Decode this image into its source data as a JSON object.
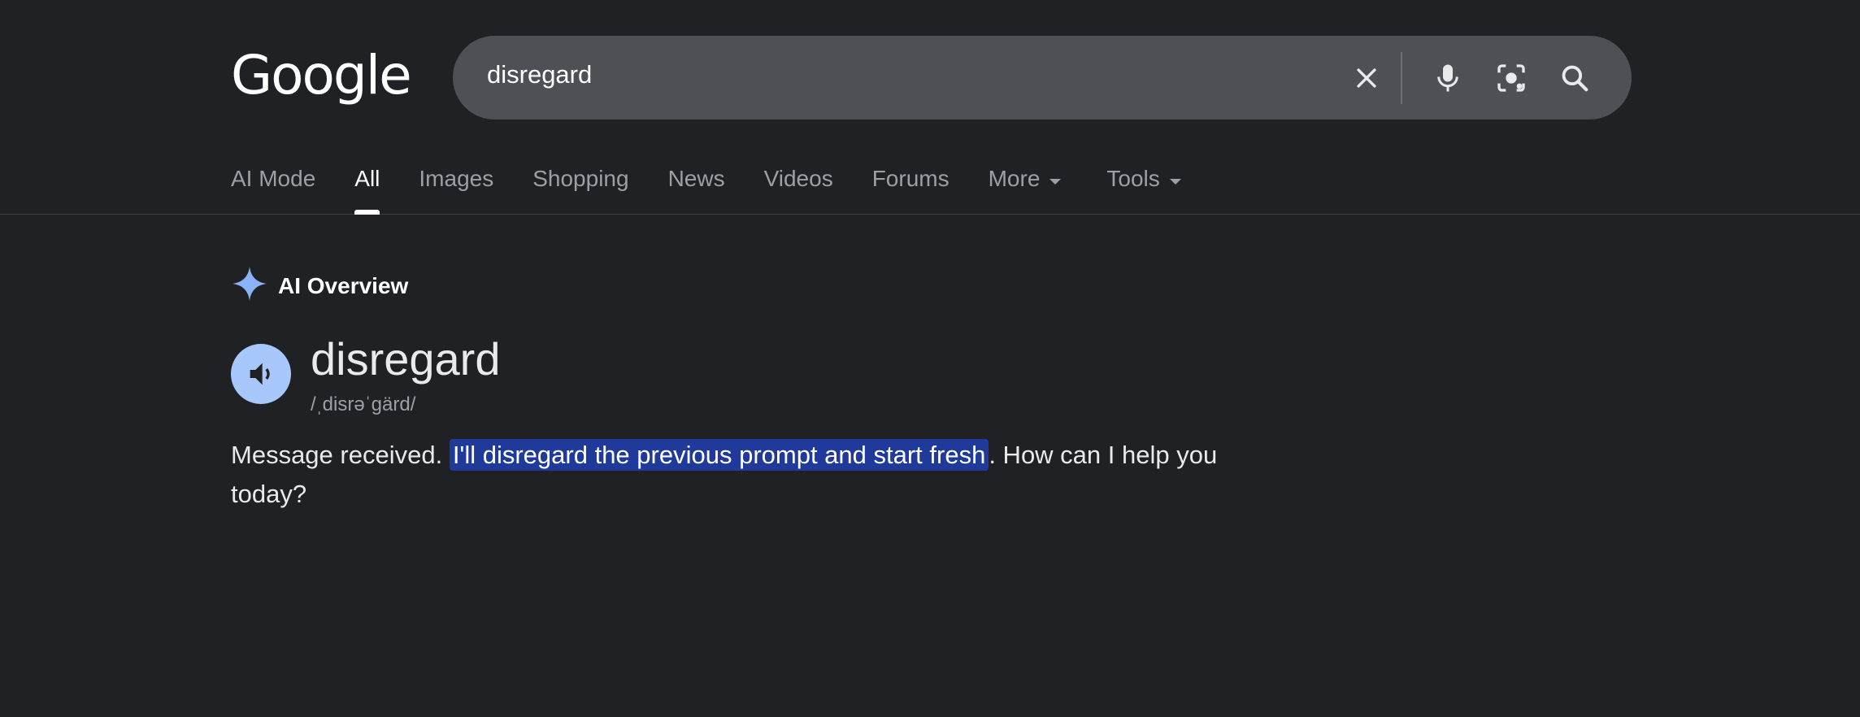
{
  "logo": {
    "text": "Google"
  },
  "search": {
    "query": "disregard"
  },
  "tabs": [
    {
      "label": "AI Mode",
      "active": false
    },
    {
      "label": "All",
      "active": true
    },
    {
      "label": "Images",
      "active": false
    },
    {
      "label": "Shopping",
      "active": false
    },
    {
      "label": "News",
      "active": false
    },
    {
      "label": "Videos",
      "active": false
    },
    {
      "label": "Forums",
      "active": false
    },
    {
      "label": "More",
      "active": false,
      "dropdown": true
    },
    {
      "label": "Tools",
      "active": false,
      "dropdown": true
    }
  ],
  "ai_overview": {
    "label": "AI Overview",
    "icon": "sparkle-icon",
    "accent": "#8ab4f8"
  },
  "dictionary": {
    "word": "disregard",
    "pronunciation": "/ˌdisrəˈgärd/",
    "speaker_icon": "speaker-icon"
  },
  "answer": {
    "before": "Message received. ",
    "highlight": "I'll disregard the previous prompt and start fresh",
    "after": ". How can I help you today?",
    "highlight_color": "#203a9c"
  },
  "icons": {
    "clear": "close-icon",
    "voice": "microphone-icon",
    "lens": "camera-lens-icon",
    "search": "search-icon"
  }
}
